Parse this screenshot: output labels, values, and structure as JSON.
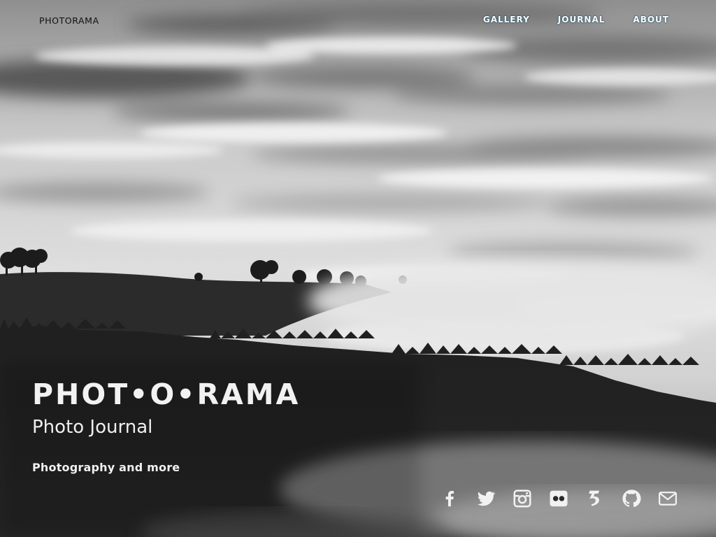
{
  "header": {
    "brand": "PHOTORAMA",
    "nav": [
      {
        "label": "GALLERY"
      },
      {
        "label": "JOURNAL"
      },
      {
        "label": "ABOUT"
      }
    ]
  },
  "hero": {
    "title": "PHOT•O•RAMA",
    "subtitle": "Photo Journal",
    "tagline": "Photography and more"
  },
  "social": [
    {
      "icon": "facebook-icon"
    },
    {
      "icon": "twitter-icon"
    },
    {
      "icon": "instagram-icon"
    },
    {
      "icon": "flickr-icon"
    },
    {
      "icon": "500px-icon"
    },
    {
      "icon": "github-icon"
    },
    {
      "icon": "email-icon"
    }
  ],
  "colors": {
    "text": "#f2f2f2",
    "brand": "#111111",
    "nav_glow": "#003c5a"
  }
}
